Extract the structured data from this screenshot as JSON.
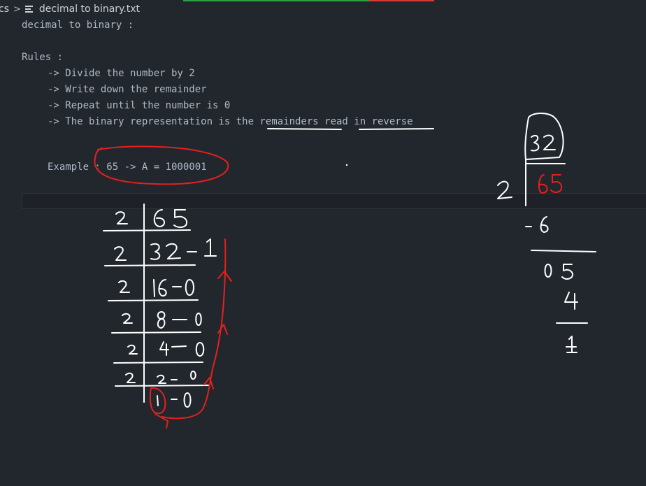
{
  "breadcrumb": {
    "parent": "cs",
    "file_name": "decimal to binary.txt"
  },
  "editor": {
    "lines": [
      "decimal to binary :",
      "Rules :",
      "-> Divide the number by 2",
      "-> Write down the remainder",
      "-> Repeat until the number is 0",
      "-> The binary representation is the remainders read in reverse",
      "Example : 65 -> A = 1000001"
    ]
  },
  "colors": {
    "background": "#22272e",
    "text": "#adbac7",
    "ink_white": "#ffffff",
    "ink_red": "#e5201d",
    "progress_green": "#2ea043",
    "progress_red": "#d73a3a"
  }
}
